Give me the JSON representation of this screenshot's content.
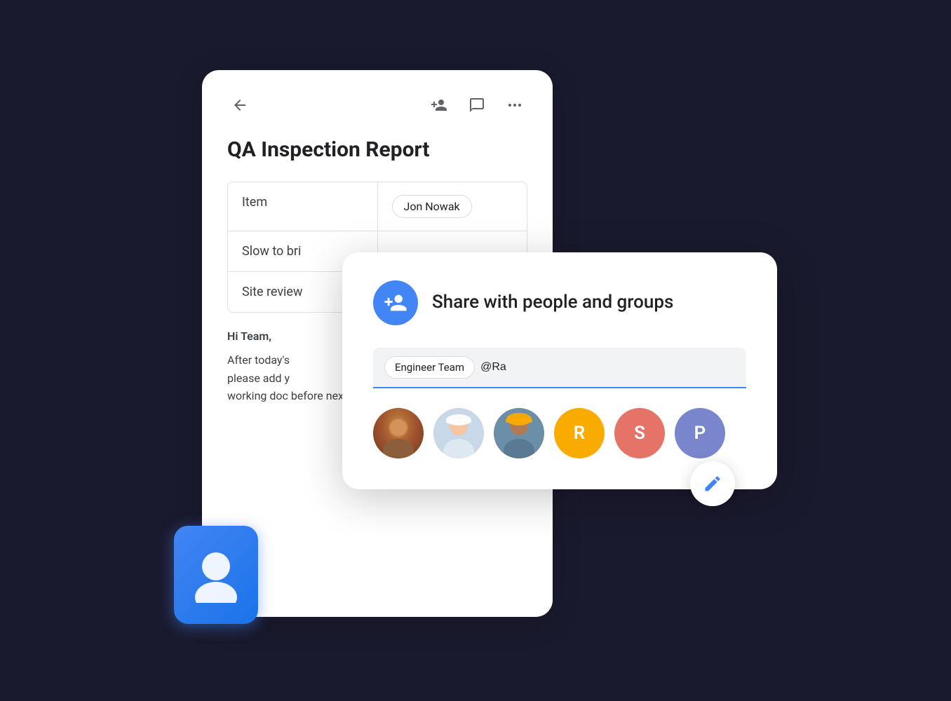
{
  "scene": {
    "doc_card": {
      "title": "QA Inspection Report",
      "back_icon": "←",
      "add_person_icon": "person-add",
      "comment_icon": "comment",
      "more_icon": "more-horiz",
      "table": {
        "rows": [
          {
            "label": "Item",
            "value": "Jon Nowak"
          },
          {
            "label": "Slow to bri",
            "value": ""
          },
          {
            "label": "Site review",
            "value": ""
          }
        ]
      },
      "body": {
        "greeting": "Hi Team,",
        "text": "After today's please add y working doc before next week."
      }
    },
    "share_dialog": {
      "title": "Share with people and groups",
      "share_icon": "person-add",
      "input": {
        "tag": "Engineer Team",
        "typed_text": "@Ra"
      },
      "avatars": [
        {
          "type": "photo",
          "label": "person-1"
        },
        {
          "type": "photo",
          "label": "person-2"
        },
        {
          "type": "photo",
          "label": "person-3"
        },
        {
          "type": "initial",
          "letter": "R",
          "color": "#f9ab00"
        },
        {
          "type": "initial",
          "letter": "S",
          "color": "#e57368"
        },
        {
          "type": "initial",
          "letter": "P",
          "color": "#7986cb"
        }
      ]
    },
    "edit_fab": {
      "icon": "edit"
    },
    "person_card": {
      "color": "#4285f4"
    }
  }
}
